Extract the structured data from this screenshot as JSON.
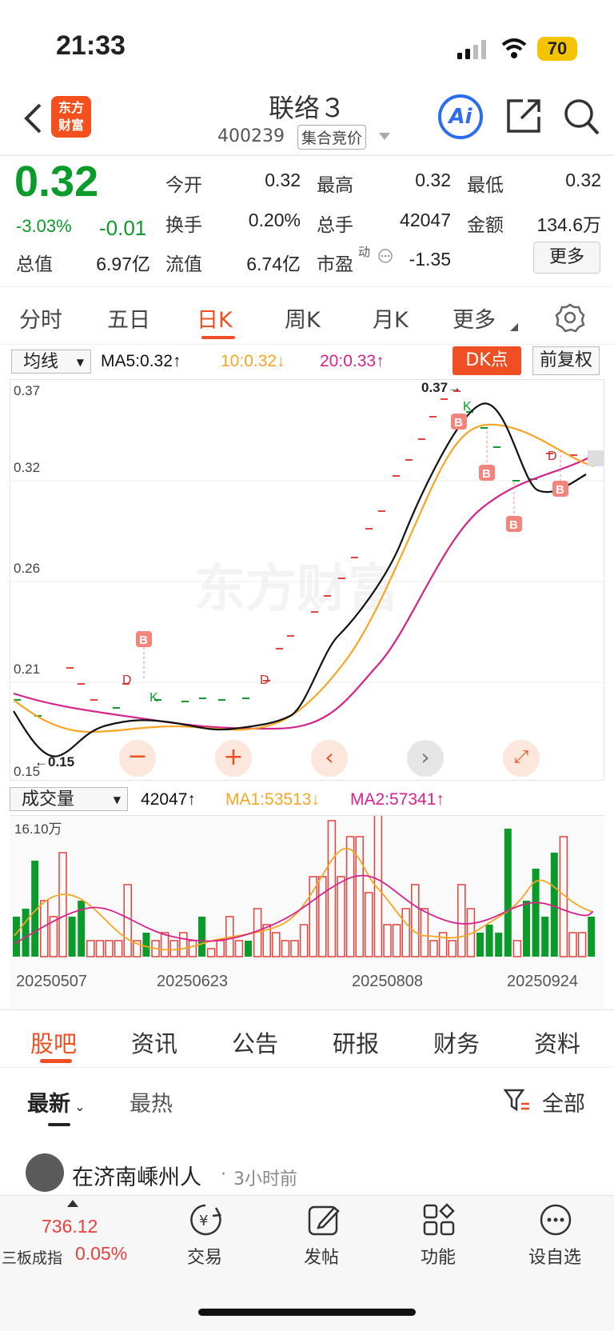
{
  "status": {
    "time": "21:33",
    "battery": "70"
  },
  "header": {
    "logo_line1": "东方",
    "logo_line2": "财富",
    "title": "联络３",
    "code": "400239",
    "badge": "集合竞价",
    "ai": "Ai"
  },
  "quote": {
    "price": "0.32",
    "change_pct": "-3.03%",
    "change": "-0.01",
    "open_label": "今开",
    "open": "0.32",
    "high_label": "最高",
    "high": "0.32",
    "low_label": "最低",
    "low": "0.32",
    "turnover_label": "换手",
    "turnover": "0.20%",
    "volume_label": "总手",
    "volume": "42047",
    "amount_label": "金额",
    "amount": "134.6万",
    "mktcap_label": "总值",
    "mktcap": "6.97亿",
    "float_label": "流值",
    "float": "6.74亿",
    "pe_label": "市盈",
    "pe_sup": "动",
    "pe": "-1.35",
    "more": "更多"
  },
  "chart_tabs": [
    "分时",
    "五日",
    "日K",
    "周K",
    "月K",
    "更多"
  ],
  "kline": {
    "ma_select": "均线",
    "ma5": "MA5:0.32↑",
    "ma10": "10:0.32↓",
    "ma20": "20:0.33↑",
    "dk_button": "DK点",
    "adjust_button": "前复权",
    "y_labels": [
      "0.37",
      "0.32",
      "0.26",
      "0.21",
      "0.15"
    ],
    "max_label": "0.37→",
    "min_label": "←0.15",
    "watermark": "东方财富",
    "colors": {
      "ma5": "#111111",
      "ma10": "#f6a623",
      "ma20": "#d6238c",
      "up": "#e8403a",
      "down": "#0a9b2a"
    }
  },
  "volume": {
    "select": "成交量",
    "vol": "42047↑",
    "ma1": "MA1:53513↓",
    "ma2": "MA2:57341↑",
    "max_label": "16.10万",
    "dates": [
      "20250507",
      "20250623",
      "20250808",
      "20250924"
    ]
  },
  "content_tabs": [
    "股吧",
    "资讯",
    "公告",
    "研报",
    "财务",
    "资料"
  ],
  "sort_tabs": {
    "latest": "最新",
    "hot": "最热",
    "filter": "全部"
  },
  "post": {
    "author": "在济南嵊州人",
    "time": "3小时前"
  },
  "bottom_nav": {
    "index_value": "736.12",
    "index_name": "三板成指",
    "index_change": "0.05%",
    "items": [
      "交易",
      "发帖",
      "功能",
      "设自选"
    ]
  },
  "chart_data": {
    "type": "candlestick",
    "y_ticks": [
      0.37,
      0.32,
      0.26,
      0.21,
      0.15
    ],
    "ylim": [
      0.15,
      0.37
    ],
    "x_ticks": [
      "20250507",
      "20250623",
      "20250808",
      "20250924"
    ],
    "ma5_latest": 0.32,
    "ma10_latest": 0.32,
    "ma20_latest": 0.33,
    "high": 0.37,
    "low": 0.15,
    "volume_max": "16.10万",
    "volume_latest": 42047,
    "vol_ma1": 53513,
    "vol_ma2": 57341
  }
}
